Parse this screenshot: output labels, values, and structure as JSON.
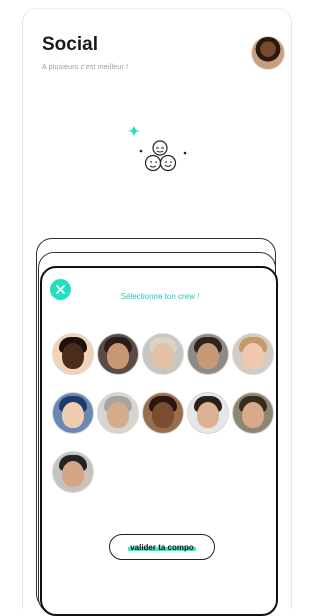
{
  "header": {
    "title": "Social",
    "subtitle": "A plusieurs c'est meilleur !"
  },
  "colors": {
    "accent": "#1ee1c0",
    "text": "#1b1b1b",
    "muted": "#9a9a9a"
  },
  "card": {
    "title": "Sélectionne ton crew !",
    "close_icon": "close-icon",
    "avatars": [
      {
        "name": "avatar-1",
        "bg": "#f2d3b5",
        "skin": "#4a2c1c",
        "hair": "#1c120c"
      },
      {
        "name": "avatar-2",
        "bg": "#5a4c44",
        "skin": "#c99674",
        "hair": "#2a1e1a"
      },
      {
        "name": "avatar-3",
        "bg": "#c9c6c1",
        "skin": "#e4c1a6",
        "hair": "#d9d2c5"
      },
      {
        "name": "avatar-4",
        "bg": "#8f8a85",
        "skin": "#c59876",
        "hair": "#2b2521"
      },
      {
        "name": "avatar-5",
        "bg": "#d4cbc5",
        "skin": "#f0c8ad",
        "hair": "#c49a6a"
      },
      {
        "name": "avatar-6",
        "bg": "#6a87b5",
        "skin": "#f0cdb0",
        "hair": "#1d3a6a"
      },
      {
        "name": "avatar-7",
        "bg": "#d8d4d0",
        "skin": "#d5ac8b",
        "hair": "#a7a39e"
      },
      {
        "name": "avatar-8",
        "bg": "#9a6d4c",
        "skin": "#7a4c30",
        "hair": "#2a160c"
      },
      {
        "name": "avatar-9",
        "bg": "#e7e7e7",
        "skin": "#dcb195",
        "hair": "#2b211c"
      },
      {
        "name": "avatar-10",
        "bg": "#8d8670",
        "skin": "#d8a98a",
        "hair": "#3a2a20"
      },
      {
        "name": "avatar-11",
        "bg": "#c6c2bd",
        "skin": "#d6a487",
        "hair": "#232323"
      }
    ],
    "validate_label": "valider ta compo"
  }
}
